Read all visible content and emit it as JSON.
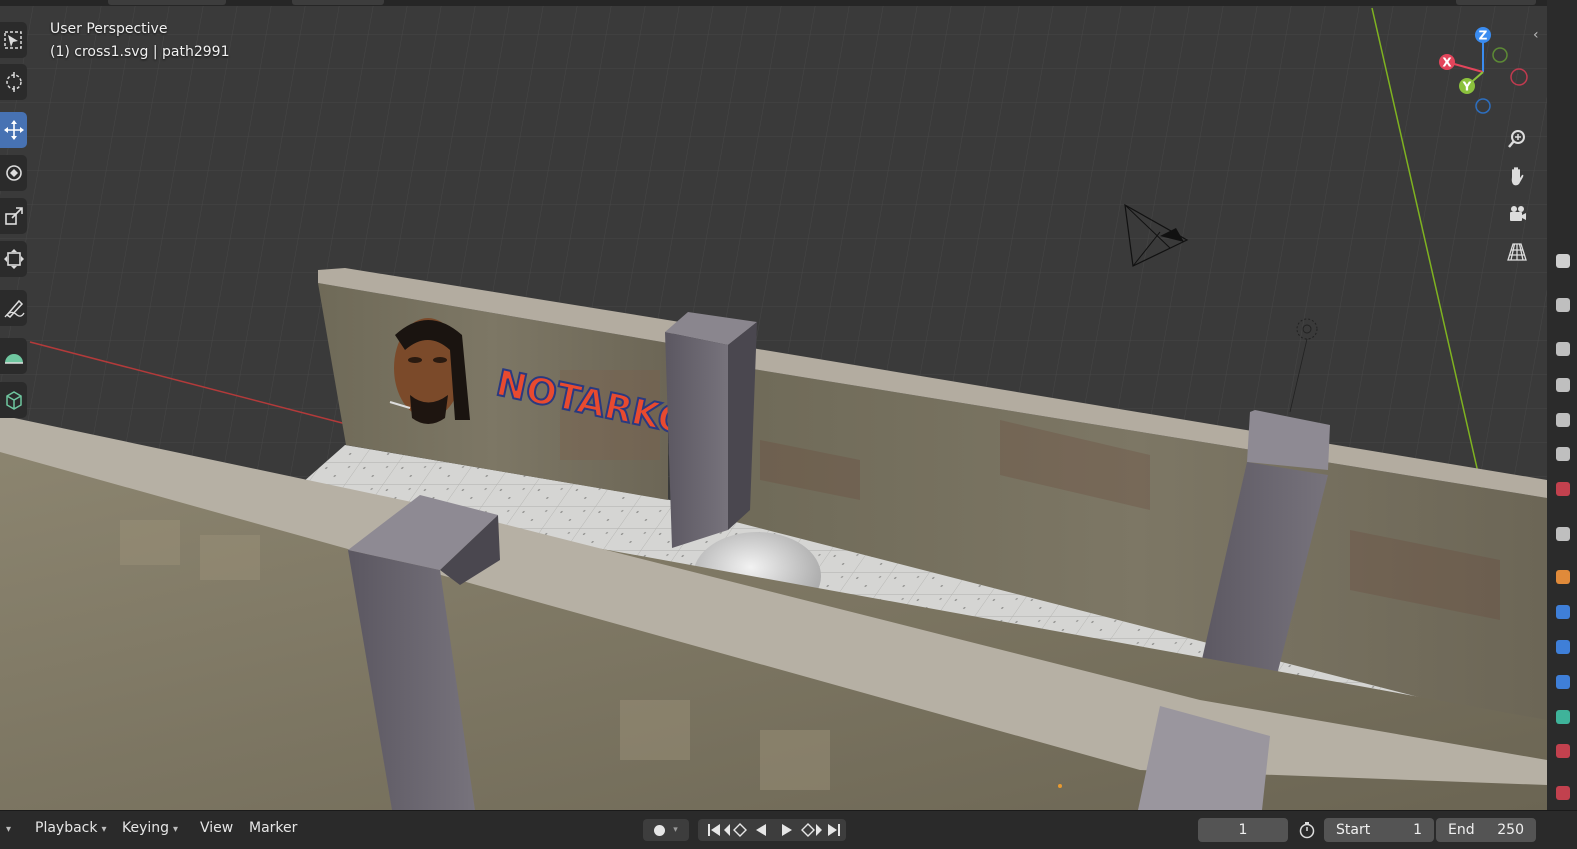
{
  "viewport": {
    "view_name": "User Perspective",
    "active_object": "(1) cross1.svg | path2991",
    "scene": {
      "left_mural_text": "NOTARKO"
    }
  },
  "toolbar": {
    "tools": [
      {
        "icon": "select-box-icon"
      },
      {
        "icon": "cursor-icon"
      },
      {
        "icon": "move-icon",
        "active": true
      },
      {
        "icon": "rotate-icon"
      },
      {
        "icon": "scale-icon"
      },
      {
        "icon": "transform-icon"
      },
      {
        "icon": "annotate-icon"
      },
      {
        "icon": "measure-icon"
      },
      {
        "icon": "add-cube-icon"
      }
    ]
  },
  "nav_gizmo": {
    "axes": {
      "x": "X",
      "y": "Y",
      "z": "Z"
    },
    "colors": {
      "x": "#e2455b",
      "y": "#8bc13d",
      "z": "#3a8cf0"
    }
  },
  "nav_buttons": [
    "zoom-icon",
    "pan-hand-icon",
    "camera-view-icon",
    "perspective-grid-icon"
  ],
  "timeline": {
    "menus": {
      "playback": "Playback",
      "keying": "Keying",
      "view": "View",
      "marker": "Marker"
    },
    "current_frame": "1",
    "start_label": "Start",
    "start_value": "1",
    "end_label": "End",
    "end_value": "250"
  },
  "colors": {
    "accent": "#4772b3",
    "x_axis_line": "#b33a3a",
    "y_axis_line": "#7fb320"
  }
}
